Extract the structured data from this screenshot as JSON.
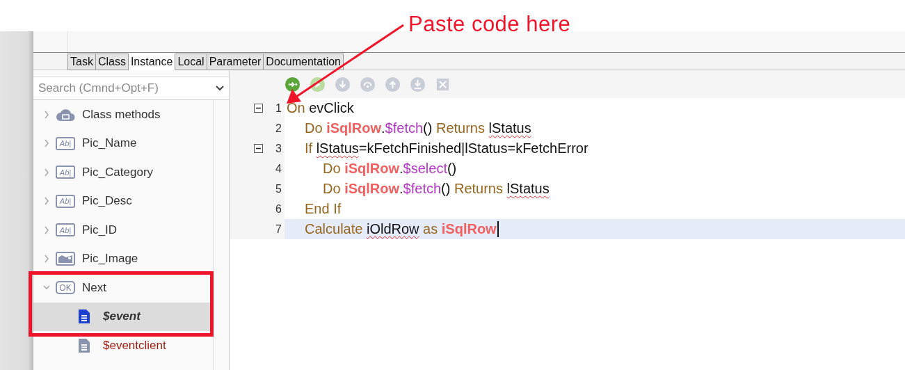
{
  "annotation": {
    "text": "Paste code here"
  },
  "tabs": [
    {
      "label": "Task",
      "selected": false
    },
    {
      "label": "Class",
      "selected": false
    },
    {
      "label": "Instance",
      "selected": true
    },
    {
      "label": "Local",
      "selected": false
    },
    {
      "label": "Parameter",
      "selected": false
    },
    {
      "label": "Documentation",
      "selected": false
    }
  ],
  "search": {
    "placeholder": "Search (Cmnd+Opt+F)"
  },
  "tree": [
    {
      "label": "Class methods",
      "kind": "group",
      "expanded": false
    },
    {
      "label": "Pic_Name",
      "kind": "field",
      "icon_label": "Ab|",
      "expanded": false
    },
    {
      "label": "Pic_Category",
      "kind": "field",
      "icon_label": "Ab|",
      "expanded": false
    },
    {
      "label": "Pic_Desc",
      "kind": "field",
      "icon_label": "Ab|",
      "expanded": false
    },
    {
      "label": "Pic_ID",
      "kind": "field",
      "icon_label": "Ab|",
      "expanded": false
    },
    {
      "label": "Pic_Image",
      "kind": "picture-field",
      "expanded": false
    },
    {
      "label": "Next",
      "kind": "button",
      "icon_label": "OK",
      "expanded": true,
      "children": [
        {
          "label": "$event",
          "kind": "method",
          "selected": true,
          "color": "#333333"
        },
        {
          "label": "$eventclient",
          "kind": "method",
          "selected": false,
          "color": "#9a1b0e"
        }
      ]
    }
  ],
  "toolbar": [
    {
      "kind": "go",
      "disabled": false
    },
    {
      "kind": "run",
      "disabled": true
    },
    {
      "kind": "step-in",
      "disabled": true
    },
    {
      "kind": "step-over",
      "disabled": true
    },
    {
      "kind": "step-out",
      "disabled": true
    },
    {
      "kind": "step-to",
      "disabled": true
    },
    {
      "kind": "clear",
      "disabled": true
    }
  ],
  "code": [
    {
      "number": "1",
      "fold": true,
      "current": false,
      "tokens": [
        {
          "text": "On",
          "kind": "keyword",
          "squiggle": false
        },
        {
          "text": " evClick",
          "kind": "plain",
          "squiggle": false
        }
      ],
      "children": [
        {
          "number": "2",
          "fold": false,
          "current": false,
          "tokens": [
            {
              "text": "Do ",
              "kind": "keyword",
              "squiggle": false
            },
            {
              "text": "iSqlRow",
              "kind": "variable",
              "squiggle": false
            },
            {
              "text": ".",
              "kind": "plain",
              "squiggle": false
            },
            {
              "text": "$fetch",
              "kind": "method",
              "squiggle": false
            },
            {
              "text": "() ",
              "kind": "plain",
              "squiggle": false
            },
            {
              "text": "Returns ",
              "kind": "keyword",
              "squiggle": false
            },
            {
              "text": "lStatus",
              "kind": "plain",
              "squiggle": true
            }
          ]
        },
        {
          "number": "3",
          "fold": true,
          "current": false,
          "tokens": [
            {
              "text": "If ",
              "kind": "keyword",
              "squiggle": false
            },
            {
              "text": "lStatus",
              "kind": "plain",
              "squiggle": true
            },
            {
              "text": "=kFetchFinished|lStatus=kFetchError",
              "kind": "plain",
              "squiggle": false
            }
          ],
          "children": [
            {
              "number": "4",
              "fold": false,
              "current": false,
              "tokens": [
                {
                  "text": "Do ",
                  "kind": "keyword",
                  "squiggle": false
                },
                {
                  "text": "iSqlRow",
                  "kind": "variable",
                  "squiggle": false
                },
                {
                  "text": ".",
                  "kind": "plain",
                  "squiggle": false
                },
                {
                  "text": "$select",
                  "kind": "method",
                  "squiggle": false
                },
                {
                  "text": "()",
                  "kind": "plain",
                  "squiggle": false
                }
              ]
            },
            {
              "number": "5",
              "fold": false,
              "current": false,
              "tokens": [
                {
                  "text": "Do ",
                  "kind": "keyword",
                  "squiggle": false
                },
                {
                  "text": "iSqlRow",
                  "kind": "variable",
                  "squiggle": false
                },
                {
                  "text": ".",
                  "kind": "plain",
                  "squiggle": false
                },
                {
                  "text": "$fetch",
                  "kind": "method",
                  "squiggle": false
                },
                {
                  "text": "() ",
                  "kind": "plain",
                  "squiggle": false
                },
                {
                  "text": "Returns ",
                  "kind": "keyword",
                  "squiggle": false
                },
                {
                  "text": "lStatus",
                  "kind": "plain",
                  "squiggle": true
                }
              ]
            }
          ]
        },
        {
          "number": "6",
          "fold": false,
          "current": false,
          "tokens": [
            {
              "text": "End If",
              "kind": "keyword",
              "squiggle": false
            }
          ]
        },
        {
          "number": "7",
          "fold": false,
          "current": true,
          "tokens": [
            {
              "text": "Calculate ",
              "kind": "keyword",
              "squiggle": false
            },
            {
              "text": "iOldRow",
              "kind": "plain",
              "squiggle": true
            },
            {
              "text": " as ",
              "kind": "keyword",
              "squiggle": false
            },
            {
              "text": "iSqlRow",
              "kind": "variable",
              "squiggle": false
            }
          ]
        }
      ]
    }
  ]
}
